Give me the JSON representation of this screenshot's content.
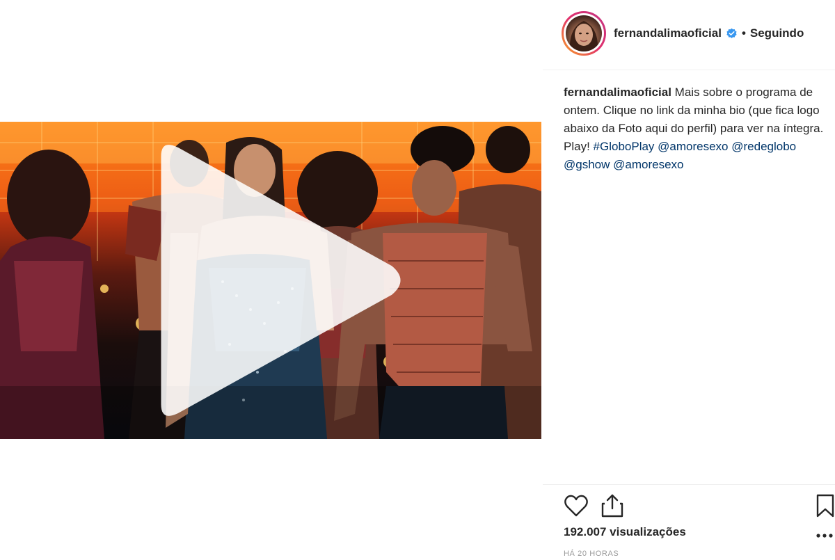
{
  "post": {
    "username": "fernandalimaoficial",
    "separator": "•",
    "follow_status": "Seguindo",
    "caption": {
      "username": "fernandalimaoficial",
      "text": "Mais sobre o programa de ontem. Clique no link da minha bio (que fica logo abaixo da Foto aqui do perfil) para ver na íntegra. Play!",
      "tags": [
        "#GloboPlay",
        "@amoresexo",
        "@redeglobo",
        "@gshow",
        "@amoresexo"
      ]
    },
    "views": "192.007 visualizações",
    "timestamp": "HÁ 20 HORAS"
  },
  "icons": {
    "verified": "verified-badge-icon",
    "play": "play-icon",
    "like": "heart-icon",
    "share": "share-icon",
    "save": "bookmark-icon",
    "more": "more-options-icon"
  },
  "colors": {
    "text": "#262626",
    "link": "#003569",
    "verified": "#3897f0",
    "muted": "#999999",
    "divider": "#efefef"
  }
}
